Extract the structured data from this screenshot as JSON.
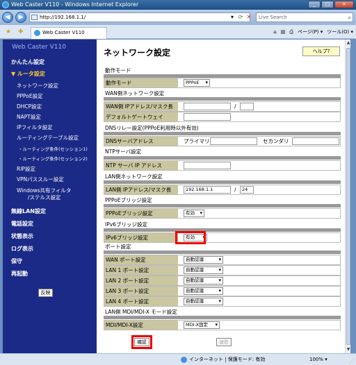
{
  "window": {
    "title": "Web Caster V110 - Windows Internet Explorer",
    "buttons": [
      "_",
      "□",
      "×"
    ]
  },
  "browser": {
    "url": "http://192.168.1.1/",
    "search_placeholder": "Live Search",
    "tab_title": "Web Caster V110",
    "tools": [
      "ページ(P) ▾",
      "ツール(O) ▾"
    ],
    "status_zone": "インターネット | 保護モード: 有効",
    "zoom": "100% ▾"
  },
  "sidebar": {
    "brand": "Web Caster V110",
    "items": [
      {
        "label": "かんたん設定",
        "level": 0
      },
      {
        "label": "▼ ルータ設定",
        "level": 0,
        "active": true
      },
      {
        "label": "ネットワーク設定",
        "level": 1
      },
      {
        "label": "PPPoE設定",
        "level": 1
      },
      {
        "label": "DHCP設定",
        "level": 1
      },
      {
        "label": "NAPT設定",
        "level": 1
      },
      {
        "label": "IPフィルタ設定",
        "level": 1
      },
      {
        "label": "ルーティングテーブル設定",
        "level": 1
      },
      {
        "label": "・ルーティング条件(セッション1)",
        "level": 2
      },
      {
        "label": "・ルーティング条件(セッション2)",
        "level": 2
      },
      {
        "label": "RIP設定",
        "level": 1
      },
      {
        "label": "VPNパススルー設定",
        "level": 1
      },
      {
        "label": "Windows共有フィルタ",
        "level": 1
      },
      {
        "label": "/ステルス設定",
        "level": 1
      },
      {
        "label": "無線LAN設定",
        "level": 0
      },
      {
        "label": "電話設定",
        "level": 0
      },
      {
        "label": "状態表示",
        "level": 0
      },
      {
        "label": "ログ表示",
        "level": 0
      },
      {
        "label": "保守",
        "level": 0
      },
      {
        "label": "再起動",
        "level": 0
      }
    ],
    "apply_button": "反映"
  },
  "main": {
    "title": "ネットワーク設定",
    "help_button": "ヘルプ?",
    "sections": {
      "mode": "動作モード",
      "wan": "WAN側ネットワーク設定",
      "dns_relay": "DNSリレー設定(PPPoE利用時以外有効)",
      "ntp": "NTPサーバ設定",
      "lan": "LAN側ネットワーク設定",
      "pppoe_bridge": "PPPoEブリッジ設定",
      "ipv6_bridge": "IPv6ブリッジ設定",
      "port": "ポート設定",
      "mdi": "LAN側 MDI/MDI-X モード設定"
    },
    "rows": {
      "mode_label": "動作モード",
      "mode_value": "PPPoE",
      "wan_ip_label": "WAN側 IPアドレス/マスク長",
      "gateway_label": "デフォルトゲートウェイ",
      "dns_label": "DNSサーバアドレス",
      "dns_primary": "プライマリ",
      "dns_secondary": "セカンダリ",
      "ntp_label": "NTP サーバ IP アドレス",
      "lan_ip_label": "LAN側 IPアドレス/マスク長",
      "lan_ip": "192.168.1.1",
      "lan_mask": "24",
      "pppoe_bridge_label": "PPPoEブリッジ設定",
      "pppoe_bridge_value": "有効",
      "ipv6_bridge_label": "IPv6ブリッジ設定",
      "ipv6_bridge_value": "有効",
      "ports": [
        {
          "label": "WAN ポート設定",
          "value": "自動認識"
        },
        {
          "label": "LAN 1 ポート設定",
          "value": "自動認識"
        },
        {
          "label": "LAN 2 ポート設定",
          "value": "自動認識"
        },
        {
          "label": "LAN 3 ポート設定",
          "value": "自動認識"
        },
        {
          "label": "LAN 4 ポート設定",
          "value": "自動認識"
        }
      ],
      "mdi_label": "MDI/MDI-X設定",
      "mdi_value": "MDI-X固定",
      "slash": "/"
    },
    "confirm_button": "確認",
    "submit_button": "送信"
  }
}
